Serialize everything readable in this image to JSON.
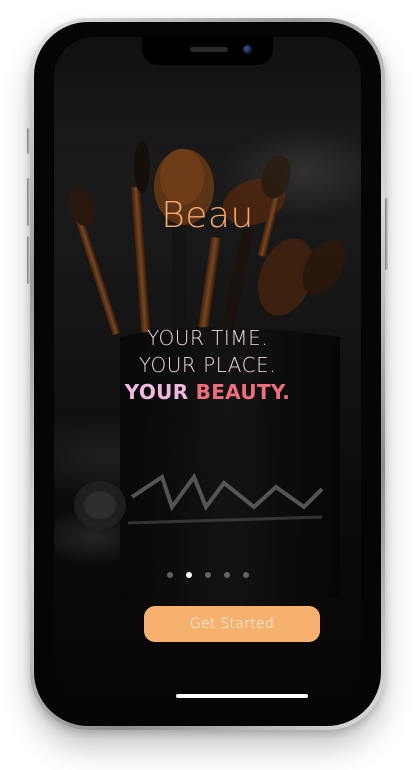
{
  "app": {
    "brand_name": "Beau"
  },
  "onboarding": {
    "tagline_line1": "YOUR TIME.",
    "tagline_line2": "YOUR PLACE.",
    "tagline_line3_word1": "YOUR",
    "tagline_line3_word2": "BEAUTY.",
    "page_count": 5,
    "active_page": 2,
    "cta_label": "Get Started"
  },
  "colors": {
    "brand": "#f4a86c",
    "tagline": "#f2d4ea",
    "tagline_emphasis": "#f2b8de",
    "accent": "#ee6e7c",
    "button": "#f7b16f",
    "button_text": "#ffffff"
  },
  "icons": {
    "camera": "front-camera-icon",
    "speaker": "earpiece-speaker-icon"
  }
}
